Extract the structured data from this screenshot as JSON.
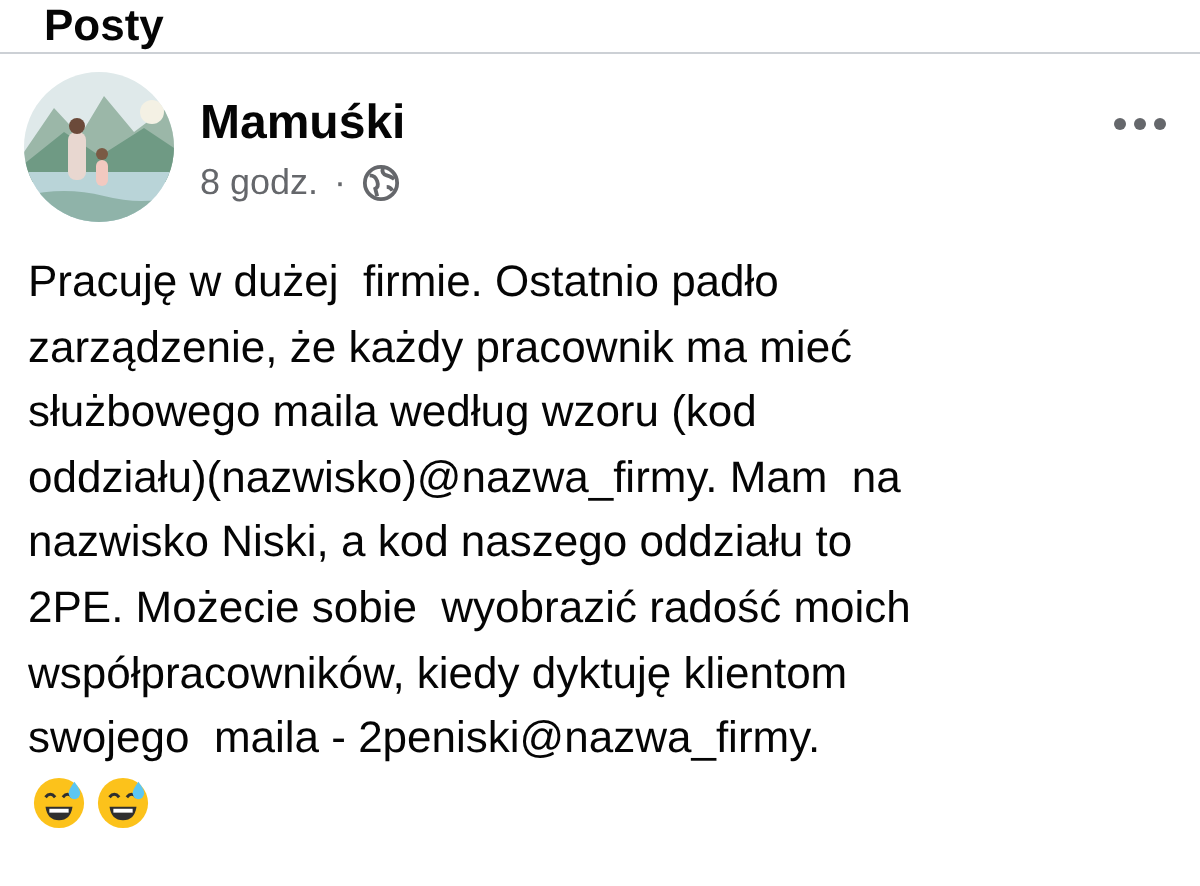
{
  "header": {
    "title": "Posty"
  },
  "post": {
    "author": "Mamuśki",
    "time": "8 godz.",
    "separator": "·",
    "text": "Pracuję w dużej  firmie. Ostatnio padło\nzarządzenie, że każdy pracownik ma mieć\nsłużbowego maila według wzoru (kod\noddziału)(nazwisko)@nazwa_firmy. Mam  na\nnazwisko Niski, a kod naszego oddziału to\n2PE. Możecie sobie  wyobrazić radość moich\nwspółpracowników, kiedy dyktuję klientom\nswojego  maila - 2peniski@nazwa_firmy.",
    "emoji": [
      {
        "kind": "sweat-smile"
      },
      {
        "kind": "sweat-smile"
      }
    ]
  }
}
